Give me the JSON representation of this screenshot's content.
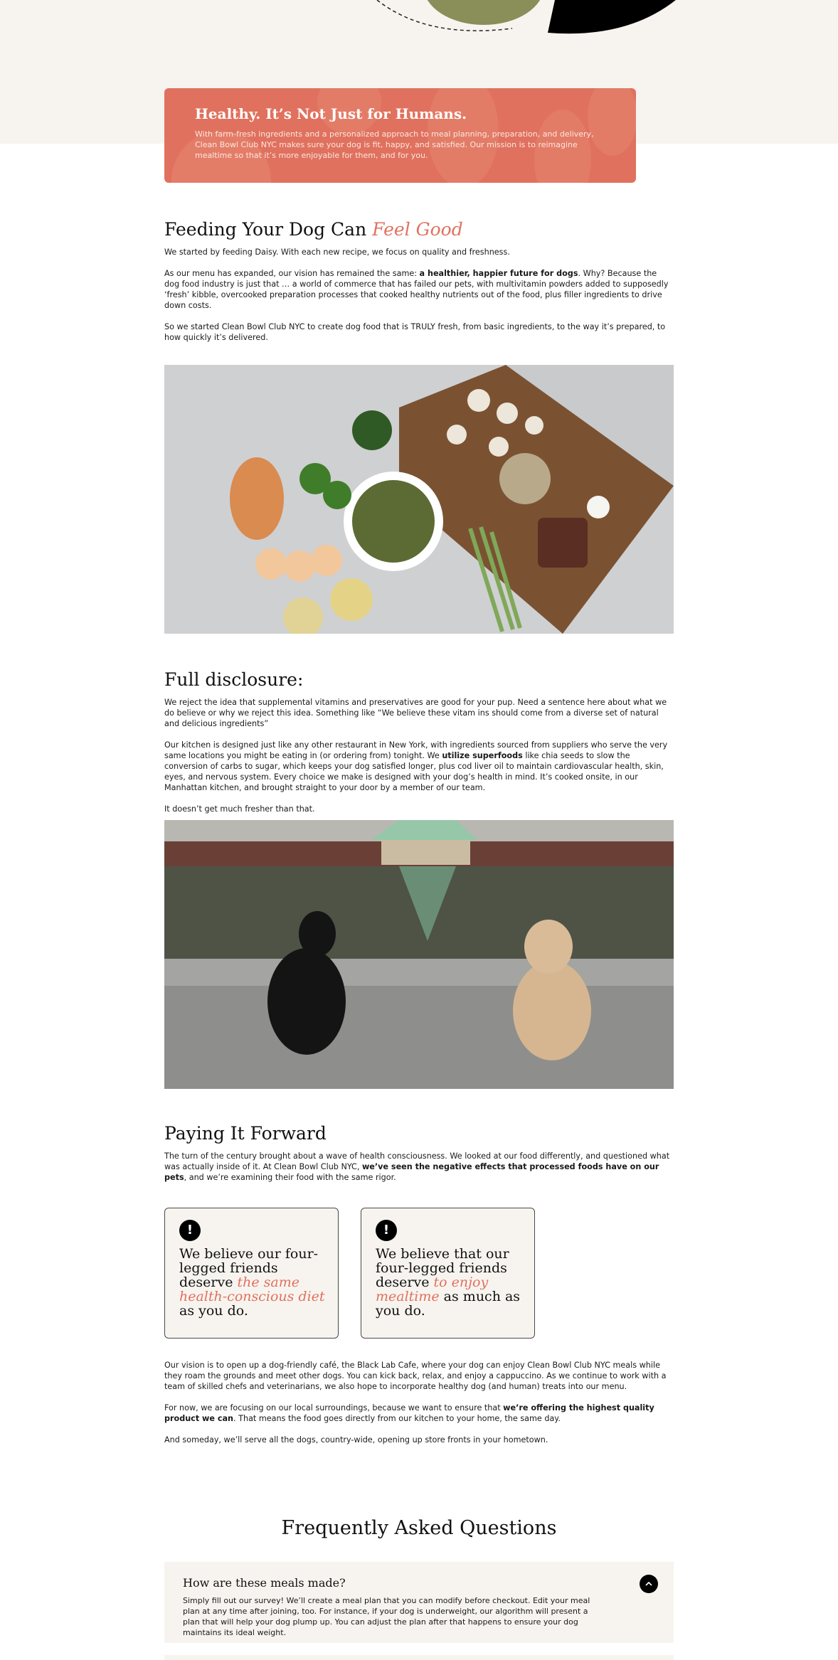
{
  "banner": {
    "title": "Healthy. It’s Not Just for Humans.",
    "text": "With farm-fresh ingredients and a personalized approach to meal planning, preparation, and delivery, Clean Bowl Club NYC makes sure your dog is fit, happy, and satisfied. Our mission is to reimagine mealtime so that it’s more enjoyable for them, and for you."
  },
  "feeding": {
    "title_plain": "Feeding Your Dog Can",
    "title_accent": "Feel Good",
    "p1": "We started by feeding Daisy. With each new recipe, we focus on quality and freshness.",
    "p2_a": "As our menu has expanded, our vision has remained the same: ",
    "p2_bold": "a healthier, happier future for dogs",
    "p2_b": ". Why? Because the dog food industry is just that … a world of commerce that has failed our pets, with multivitamin powders added to supposedly ‘fresh’ kibble, overcooked preparation processes that cooked healthy nutrients out of the food, plus filler ingredients to drive down costs.",
    "p3": "So we started Clean Bowl Club NYC to create dog food that is TRULY fresh, from basic ingredients, to the way it’s prepared, to how quickly it’s delivered."
  },
  "disclosure": {
    "title": "Full disclosure:",
    "p1": "We reject the idea that supplemental vitamins and preservatives are good for your pup. Need a sentence here about what we do believe or why we reject this idea. Something like “We believe these vitam ins should come from a diverse set of natural and delicious ingredients”",
    "p2_a": "Our kitchen is designed just like any other restaurant in New York, with ingredients sourced from suppliers who serve the very same locations you might be eating in (or ordering from) tonight. We ",
    "p2_bold": "utilize superfoods",
    "p2_b": " like chia seeds to slow the conversion of carbs to sugar, which keeps your dog satisfied longer, plus cod liver oil to maintain cardiovascular health, skin, eyes, and nervous system. Every choice we make is designed with your dog’s health in mind. It’s cooked onsite, in our Manhattan kitchen, and brought straight to your door by a member of our team.",
    "p3": "It doesn’t get much fresher than that."
  },
  "forward": {
    "title": "Paying It Forward",
    "p1_a": "The turn of the century brought about a wave of health consciousness. We looked at our food differently, and questioned what was actually inside of it. At Clean Bowl Club NYC, ",
    "p1_bold": "we’ve seen the negative effects that processed foods have on our pets",
    "p1_b": ", and we’re examining their food with the same rigor."
  },
  "cards": [
    {
      "icon": "!",
      "a": "We believe our four-legged friends deserve ",
      "accent": "the same health-conscious diet",
      "b": " as you do."
    },
    {
      "icon": "!",
      "a": "We believe that our four-legged friends deserve ",
      "accent": "to enjoy mealtime",
      "b": " as much as you do."
    }
  ],
  "vision": {
    "p1": "Our vision is to open up a dog-friendly café, the Black Lab Cafe, where your dog can enjoy Clean Bowl Club NYC meals while they roam the grounds and meet other dogs. You can kick back, relax, and enjoy a cappuccino. As we continue to work with a team of skilled chefs and veterinarians, we also hope to incorporate healthy dog (and human) treats into our menu.",
    "p2_a": "For now, we are focusing on our local surroundings, because we want to ensure that ",
    "p2_bold": "we’re offering the highest quality product we can",
    "p2_b": ". That means the food goes directly from our kitchen to your home, the same day.",
    "p3": "And someday, we’ll serve all the dogs, country-wide, opening up store fronts in your hometown."
  },
  "faq": {
    "title": "Frequently Asked Questions",
    "items": [
      {
        "question": "How are these meals made?",
        "answer": "Simply fill out our survey! We’ll create a meal plan that you can modify before checkout. Edit your meal plan at any time after joining, too. For instance, if your dog is underweight, our algorithm will present a plan that will help your dog plump up. You can adjust the plan after that happens to ensure your dog maintains its ideal weight."
      }
    ]
  },
  "colors": {
    "accent": "#e0715e",
    "cream": "#f7f4ef"
  },
  "icons": [
    "exclamation-icon",
    "chevron-up-icon"
  ]
}
